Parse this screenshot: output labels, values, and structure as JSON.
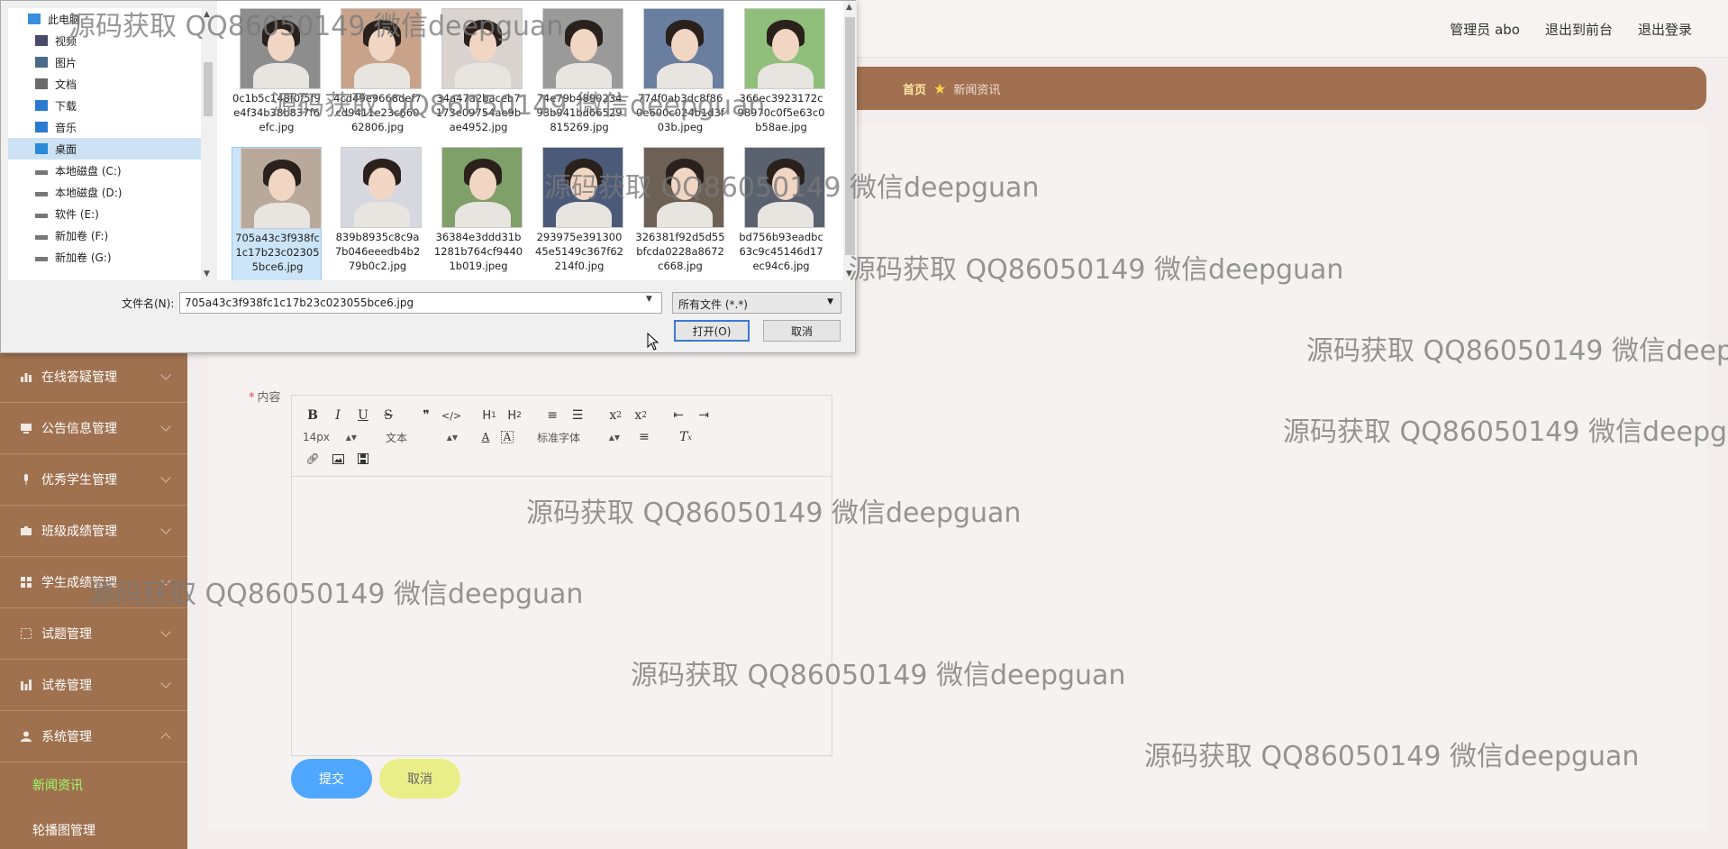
{
  "topbar": {
    "admin_label": "管理员 abo",
    "front_link": "退出到前台",
    "logout_link": "退出登录"
  },
  "breadcrumb": {
    "home": "首页",
    "current": "新闻资讯"
  },
  "sidebar": {
    "items": [
      {
        "label": "在线答疑管理",
        "icon": "chart-icon"
      },
      {
        "label": "公告信息管理",
        "icon": "monitor-icon"
      },
      {
        "label": "优秀学生管理",
        "icon": "mic-icon"
      },
      {
        "label": "班级成绩管理",
        "icon": "briefcase-icon"
      },
      {
        "label": "学生成绩管理",
        "icon": "grid-icon"
      },
      {
        "label": "试题管理",
        "icon": "dotted-square-icon"
      },
      {
        "label": "试卷管理",
        "icon": "chart-icon"
      },
      {
        "label": "系统管理",
        "icon": "user-icon"
      }
    ],
    "sub_items": [
      {
        "label": "新闻资讯",
        "active": true
      },
      {
        "label": "轮播图管理",
        "active": false
      }
    ]
  },
  "form": {
    "content_label": "内容",
    "required_mark": "*",
    "submit_label": "提交",
    "cancel_label": "取消"
  },
  "editor": {
    "font_size": "14px",
    "paragraph": "文本",
    "font_family": "标准字体",
    "row1_buttons": [
      "B",
      "I",
      "U",
      "S",
      "❞",
      "</>",
      "H1",
      "H2",
      "≡",
      "☰",
      "x₂",
      "x²",
      "⇤",
      "⇥"
    ]
  },
  "dialog": {
    "nav_items": [
      {
        "label": "此电脑",
        "icon": "computer-icon"
      },
      {
        "label": "视频",
        "icon": "video-folder-icon"
      },
      {
        "label": "图片",
        "icon": "picture-folder-icon"
      },
      {
        "label": "文档",
        "icon": "document-folder-icon"
      },
      {
        "label": "下载",
        "icon": "download-icon"
      },
      {
        "label": "音乐",
        "icon": "music-icon"
      },
      {
        "label": "桌面",
        "icon": "desktop-icon",
        "selected": true
      },
      {
        "label": "本地磁盘 (C:)",
        "icon": "drive-icon"
      },
      {
        "label": "本地磁盘 (D:)",
        "icon": "drive-icon"
      },
      {
        "label": "软件 (E:)",
        "icon": "drive-icon"
      },
      {
        "label": "新加卷 (F:)",
        "icon": "drive-icon"
      },
      {
        "label": "新加卷 (G:)",
        "icon": "drive-icon"
      }
    ],
    "files": [
      {
        "name": "0c1b5c148f0f5f9e4f34b38b837f6efc.jpg",
        "tone": "#8d8d8d"
      },
      {
        "name": "4cd49e9668def7cd9411e23c66062806.jpg",
        "tone": "#c9a28a"
      },
      {
        "name": "34a47a2baceb7173e09754ae9bae4952.jpg",
        "tone": "#d9d4cf"
      },
      {
        "name": "74e79b489023493b941bd66529815269.jpg",
        "tone": "#9a9a9a"
      },
      {
        "name": "774f0ab3dc8f860e600c024b1d3f03b.jpeg",
        "tone": "#6a7fa0"
      },
      {
        "name": "366ec3923172c98970c0f5e63c0b58ae.jpg",
        "tone": "#8fbf7a"
      },
      {
        "name": "705a43c3f938fc1c17b23c023055bce6.jpg",
        "tone": "#b9a99a",
        "selected": true
      },
      {
        "name": "839b8935c8c9a7b046eeedb4b279b0c2.jpg",
        "tone": "#d7d7e0"
      },
      {
        "name": "36384e3ddd31b1281b764cf94401b019.jpeg",
        "tone": "#7fa068"
      },
      {
        "name": "293975e39130045e5149c367f62214f0.jpg",
        "tone": "#4a5a78"
      },
      {
        "name": "326381f92d5d55bfcda0228a8672c668.jpg",
        "tone": "#6d6055"
      },
      {
        "name": "bd756b93eadbc63c9c45146d17ec94c6.jpg",
        "tone": "#5a6270"
      }
    ],
    "filename_label": "文件名(N):",
    "filename_value": "705a43c3f938fc1c17b23c023055bce6.jpg",
    "filetype": "所有文件 (*.*)",
    "open_button": "打开(O)",
    "cancel_button": "取消"
  },
  "watermark_text": "源码获取 QQ86050149 微信deepguan",
  "colors": {
    "sidebar": "#a0714f",
    "breadcrumb_bar": "#a07050",
    "submit": "#4fa7ff",
    "cancel": "#e9ee88",
    "active_sub": "#9cff6a"
  }
}
